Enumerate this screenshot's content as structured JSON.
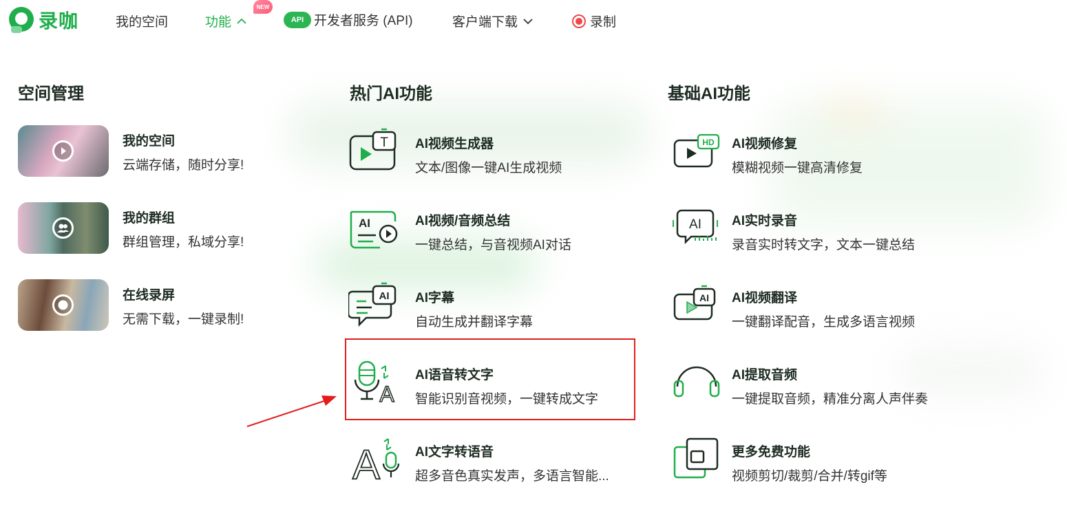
{
  "brand": {
    "name": "录咖",
    "accent": "#1fae4b"
  },
  "nav": {
    "my_space": "我的空间",
    "features": "功能",
    "new_badge": "NEW",
    "api_badge": "API",
    "developer": "开发者服务 (API)",
    "download": "客户端下载",
    "record": "录制"
  },
  "sections": {
    "space": "空间管理",
    "hot_ai": "热门AI功能",
    "basic_ai": "基础AI功能"
  },
  "space_items": [
    {
      "title": "我的空间",
      "desc": "云端存储，随时分享!"
    },
    {
      "title": "我的群组",
      "desc": "群组管理，私域分享!"
    },
    {
      "title": "在线录屏",
      "desc": "无需下载，一键录制!"
    }
  ],
  "hot_items": [
    {
      "title": "AI视频生成器",
      "desc": "文本/图像一键AI生成视频",
      "icon": "ai-video-generator-icon"
    },
    {
      "title": "AI视频/音频总结",
      "desc": "一键总结，与音视频AI对话",
      "icon": "ai-summary-icon"
    },
    {
      "title": "AI字幕",
      "desc": "自动生成并翻译字幕",
      "icon": "ai-subtitle-icon"
    },
    {
      "title": "AI语音转文字",
      "desc": "智能识别音视频，一键转成文字",
      "icon": "speech-to-text-icon"
    },
    {
      "title": "AI文字转语音",
      "desc": "超多音色真实发声，多语言智能...",
      "icon": "text-to-speech-icon"
    }
  ],
  "basic_items": [
    {
      "title": "AI视频修复",
      "desc": "模糊视频一键高清修复",
      "icon": "hd-video-icon",
      "hd": "HD"
    },
    {
      "title": "AI实时录音",
      "desc": "录音实时转文字，文本一键总结",
      "icon": "realtime-record-icon"
    },
    {
      "title": "AI视频翻译",
      "desc": "一键翻译配音，生成多语言视频",
      "icon": "video-translate-icon"
    },
    {
      "title": "AI提取音频",
      "desc": "一键提取音频，精准分离人声伴奏",
      "icon": "headphones-icon"
    },
    {
      "title": "更多免费功能",
      "desc": "视频剪切/裁剪/合并/转gif等",
      "icon": "more-tools-icon"
    }
  ],
  "icon_text": {
    "t": "T",
    "ai": "AI",
    "a": "A"
  },
  "colors": {
    "green": "#1fae4b",
    "dark": "#1d2b22",
    "highlight": "#e31b1b"
  }
}
